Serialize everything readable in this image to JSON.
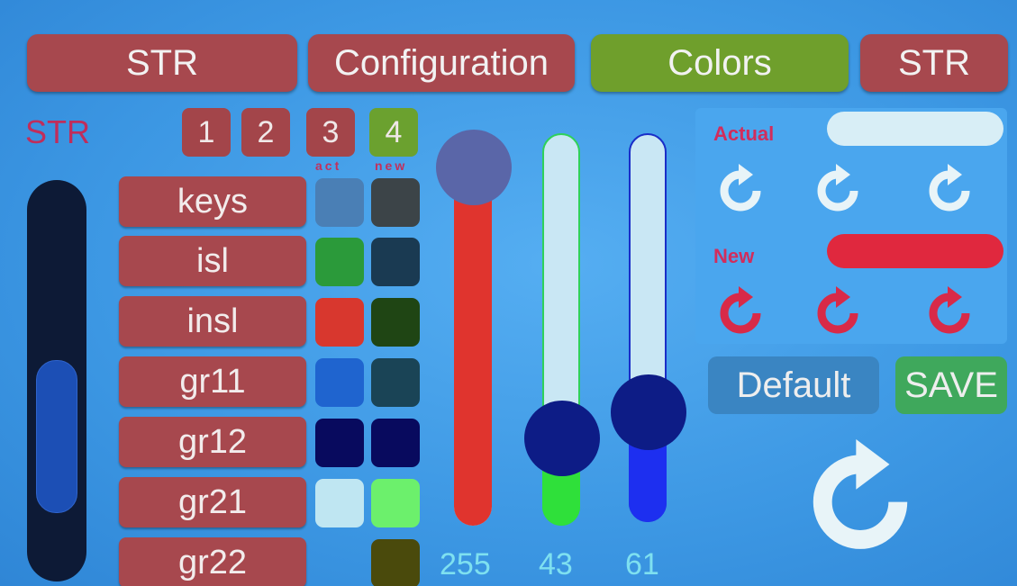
{
  "top_tabs": {
    "str_left": "STR",
    "configuration": "Configuration",
    "colors": "Colors",
    "str_right": "STR"
  },
  "side_label": "STR",
  "slots": [
    "1",
    "2",
    "3",
    "4"
  ],
  "active_slot": "4",
  "column_labels": {
    "act": "act",
    "new": "new"
  },
  "elements": [
    {
      "label": "keys",
      "act_color": "#4a7fb5",
      "new_color": "#3c4448"
    },
    {
      "label": "isl",
      "act_color": "#2b9a3a",
      "new_color": "#1a3a52"
    },
    {
      "label": "insl",
      "act_color": "#d8372e",
      "new_color": "#1f4514"
    },
    {
      "label": "gr11",
      "act_color": "#1f64cf",
      "new_color": "#1a4456"
    },
    {
      "label": "gr12",
      "act_color": "#080a5e",
      "new_color": "#080a5e"
    },
    {
      "label": "gr21",
      "act_color": "#bfe6f2",
      "new_color": "#6cf06c"
    },
    {
      "label": "gr22",
      "act_color": null,
      "new_color": "#4a4a0c"
    }
  ],
  "rgb": {
    "red": 255,
    "green": 43,
    "blue": 61
  },
  "panel": {
    "actual_label": "Actual",
    "new_label": "New",
    "actual_color": "#d8eef6",
    "new_color": "#e0283e"
  },
  "buttons": {
    "default": "Default",
    "save": "SAVE"
  },
  "colors": {
    "button_red": "#a7484e",
    "button_green": "#6f9f2c",
    "label_red": "#c02d5b",
    "value_cyan": "#7ee0f0",
    "background_blue": "#3f9ae6"
  },
  "icons": [
    "refresh-icon"
  ]
}
